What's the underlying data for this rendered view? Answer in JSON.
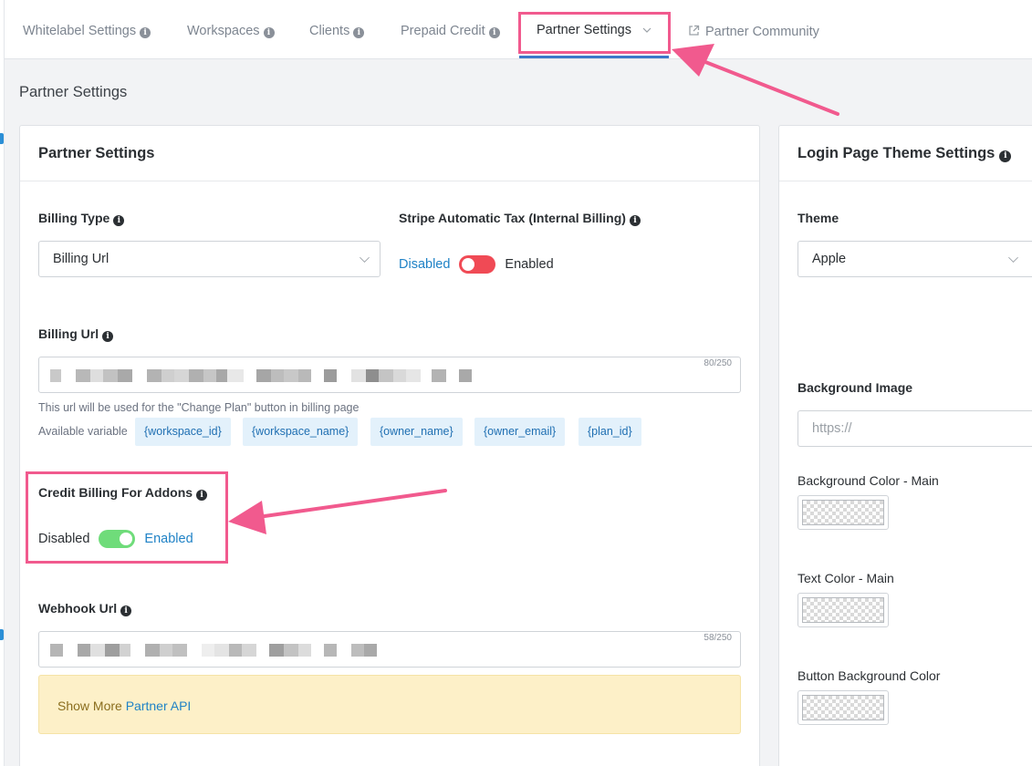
{
  "tabs": [
    {
      "label": "Whitelabel Settings"
    },
    {
      "label": "Workspaces"
    },
    {
      "label": "Clients"
    },
    {
      "label": "Prepaid Credit"
    },
    {
      "label": "Partner Settings"
    },
    {
      "label": "Partner Community"
    }
  ],
  "page_title": "Partner Settings",
  "partner_card": {
    "title": "Partner Settings",
    "billing_type": {
      "label": "Billing Type",
      "value": "Billing Url"
    },
    "stripe_tax": {
      "label": "Stripe Automatic Tax (Internal Billing)",
      "off_label": "Disabled",
      "on_label": "Enabled"
    },
    "billing_url": {
      "label": "Billing Url",
      "counter": "80/250",
      "help": "This url will be used for the \"Change Plan\" button in billing page",
      "vars_label": "Available variable",
      "variables": [
        "{workspace_id}",
        "{workspace_name}",
        "{owner_name}",
        "{owner_email}",
        "{plan_id}"
      ]
    },
    "credit_billing": {
      "label": "Credit Billing For Addons",
      "off_label": "Disabled",
      "on_label": "Enabled"
    },
    "webhook_url": {
      "label": "Webhook Url",
      "counter": "58/250"
    },
    "alert": {
      "prefix": "Show More",
      "link": "Partner API"
    }
  },
  "theme_card": {
    "title": "Login Page Theme Settings",
    "theme": {
      "label": "Theme",
      "value": "Apple"
    },
    "background_image": {
      "label": "Background Image",
      "placeholder": "https://"
    },
    "colors": [
      {
        "label": "Background Color - Main"
      },
      {
        "label": "Text Color - Main"
      },
      {
        "label": "Button Background Color"
      }
    ]
  },
  "annotation_color": "#f15a8e",
  "accent_color": "#1f82c6"
}
